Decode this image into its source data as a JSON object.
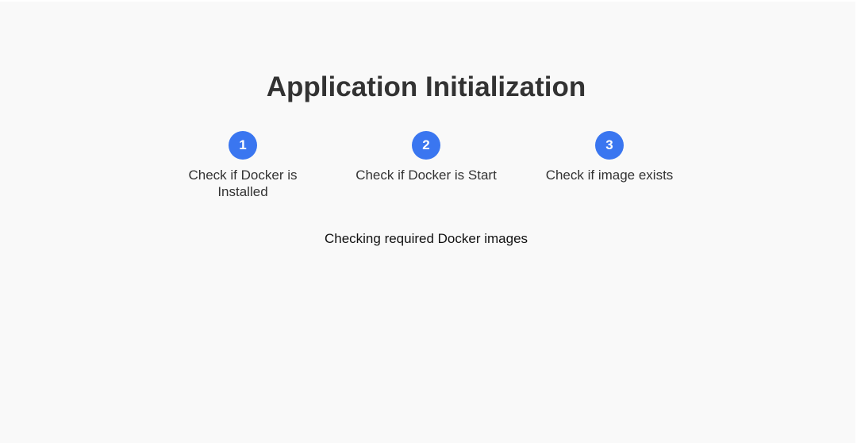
{
  "title": "Application Initialization",
  "accent_color": "#3a76f0",
  "steps": [
    {
      "number": "1",
      "label": "Check if Docker is Installed"
    },
    {
      "number": "2",
      "label": "Check if Docker is Start"
    },
    {
      "number": "3",
      "label": "Check if image exists"
    }
  ],
  "status": "Checking required Docker images"
}
